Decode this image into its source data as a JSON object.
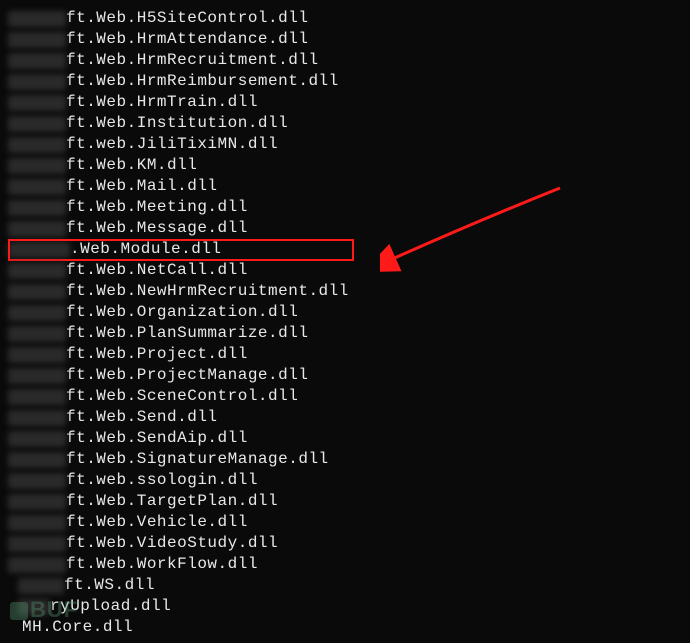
{
  "files": [
    {
      "suffix": "ft.Web.H5SiteControl.dll",
      "blur": "normal"
    },
    {
      "suffix": "ft.Web.HrmAttendance.dll",
      "blur": "normal"
    },
    {
      "suffix": "ft.Web.HrmRecruitment.dll",
      "blur": "normal"
    },
    {
      "suffix": "ft.Web.HrmReimbursement.dll",
      "blur": "normal"
    },
    {
      "suffix": "ft.Web.HrmTrain.dll",
      "blur": "normal"
    },
    {
      "suffix": "ft.Web.Institution.dll",
      "blur": "normal"
    },
    {
      "suffix": "ft.web.JiliTixiMN.dll",
      "blur": "normal"
    },
    {
      "suffix": "ft.Web.KM.dll",
      "blur": "normal"
    },
    {
      "suffix": "ft.Web.Mail.dll",
      "blur": "normal"
    },
    {
      "suffix": "ft.Web.Meeting.dll",
      "blur": "normal"
    },
    {
      "suffix": "ft.Web.Message.dll",
      "blur": "normal"
    },
    {
      "suffix": ".Web.Module.dll",
      "blur": "wide",
      "highlight": true
    },
    {
      "suffix": "ft.Web.NetCall.dll",
      "blur": "normal"
    },
    {
      "suffix": "ft.Web.NewHrmRecruitment.dll",
      "blur": "normal"
    },
    {
      "suffix": "ft.Web.Organization.dll",
      "blur": "normal"
    },
    {
      "suffix": "ft.Web.PlanSummarize.dll",
      "blur": "normal"
    },
    {
      "suffix": "ft.Web.Project.dll",
      "blur": "normal"
    },
    {
      "suffix": "ft.Web.ProjectManage.dll",
      "blur": "normal"
    },
    {
      "suffix": "ft.Web.SceneControl.dll",
      "blur": "normal"
    },
    {
      "suffix": "ft.Web.Send.dll",
      "blur": "normal"
    },
    {
      "suffix": "ft.Web.SendAip.dll",
      "blur": "normal"
    },
    {
      "suffix": "ft.Web.SignatureManage.dll",
      "blur": "normal"
    },
    {
      "suffix": "ft.web.ssologin.dll",
      "blur": "normal"
    },
    {
      "suffix": "ft.Web.TargetPlan.dll",
      "blur": "normal"
    },
    {
      "suffix": "ft.Web.Vehicle.dll",
      "blur": "normal"
    },
    {
      "suffix": "ft.Web.VideoStudy.dll",
      "blur": "normal"
    },
    {
      "suffix": "ft.Web.WorkFlow.dll",
      "blur": "normal"
    },
    {
      "suffix": "ft.WS.dll",
      "blur": "narrow"
    },
    {
      "suffix": "ryUpload.dll",
      "blur": "tiny"
    }
  ],
  "last_file": "MH.Core.dll",
  "watermark": "BUF",
  "arrow_color": "#ff1a1a"
}
